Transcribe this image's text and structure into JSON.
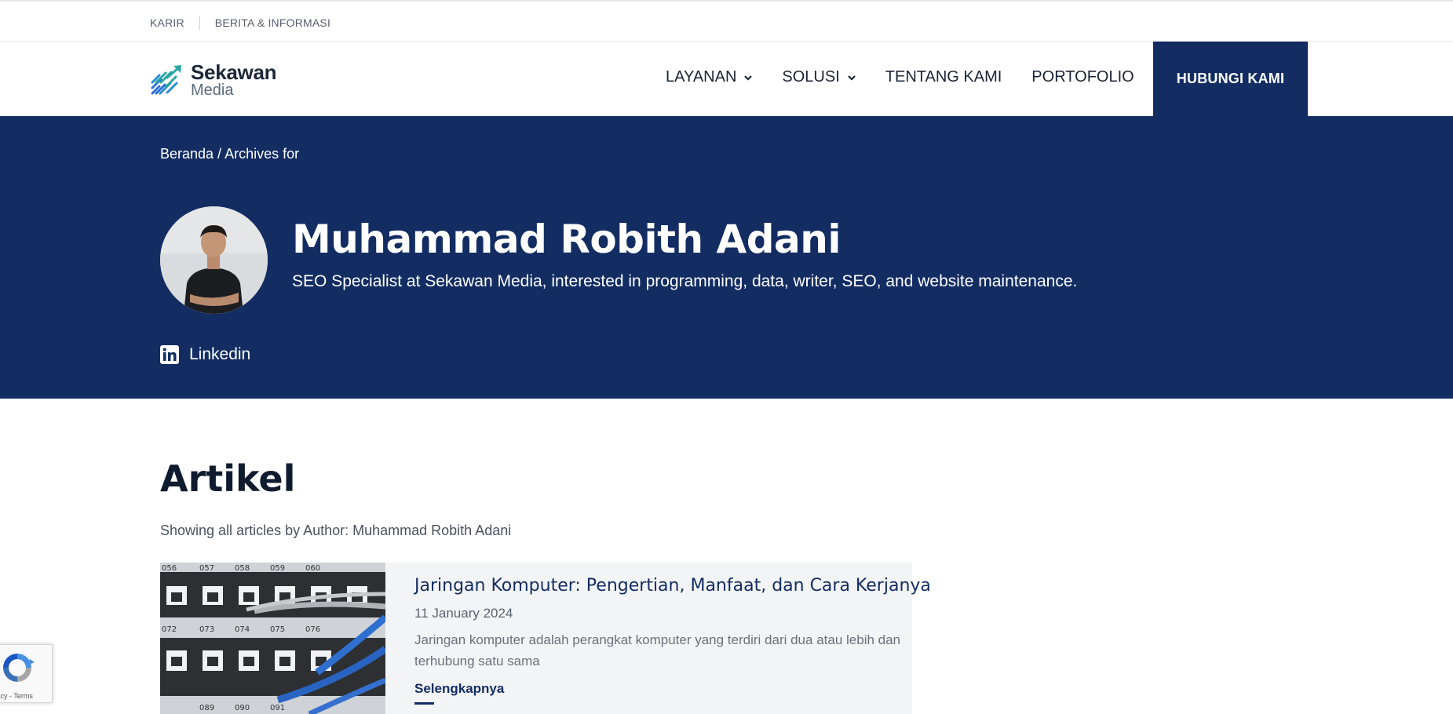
{
  "utility": {
    "links": [
      "KARIR",
      "BERITA & INFORMASI"
    ]
  },
  "brand": {
    "line1": "Sekawan",
    "line2": "Media",
    "accent_color": "#132d63",
    "logo_colors": [
      "#2aa7a3",
      "#2b6fd6"
    ]
  },
  "nav": {
    "items": [
      {
        "label": "LAYANAN",
        "has_dropdown": true
      },
      {
        "label": "SOLUSI",
        "has_dropdown": true
      },
      {
        "label": "TENTANG KAMI",
        "has_dropdown": false
      },
      {
        "label": "PORTOFOLIO",
        "has_dropdown": false
      }
    ],
    "cta": "HUBUNGI KAMI"
  },
  "hero": {
    "breadcrumb": "Beranda / Archives for",
    "author_name": "Muhammad Robith Adani",
    "author_bio": "SEO Specialist at Sekawan Media, interested in programming, data, writer, SEO, and website maintenance.",
    "social_label": "Linkedin",
    "social_icon": "linkedin-icon"
  },
  "content": {
    "title": "Artikel",
    "description": "Showing all articles by Author: Muhammad Robith Adani",
    "articles": [
      {
        "title": "Jaringan Komputer: Pengertian, Manfaat, dan Cara Kerjanya",
        "date": "11 January 2024",
        "excerpt": "Jaringan komputer adalah perangkat komputer yang terdiri dari dua atau lebih dan terhubung satu sama",
        "read_more": "Selengkapnya",
        "thumb_labels": [
          "056",
          "057",
          "058",
          "059",
          "060",
          "072",
          "073",
          "074",
          "075",
          "076",
          "089",
          "090",
          "091"
        ]
      }
    ]
  },
  "recaptcha": {
    "text": "vacy - Terms"
  }
}
